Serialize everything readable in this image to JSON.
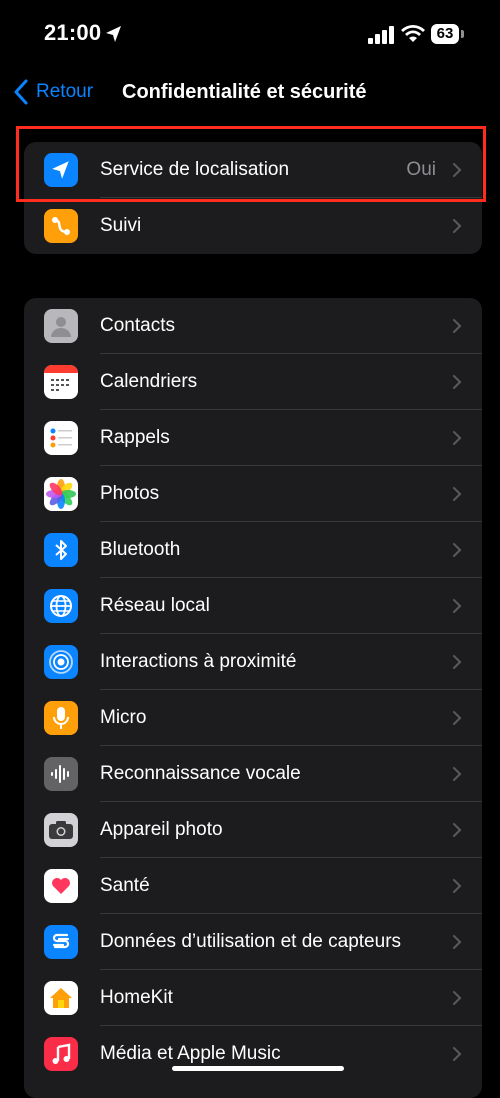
{
  "status_bar": {
    "time": "21:00",
    "battery": "63"
  },
  "nav": {
    "back_label": "Retour",
    "title": "Confidentialité et sécurité"
  },
  "group1": [
    {
      "name": "location",
      "label": "Service de localisation",
      "value": "Oui",
      "icon": "location-arrow-icon",
      "color": "#0a84ff"
    },
    {
      "name": "tracking",
      "label": "Suivi",
      "value": "",
      "icon": "tracking-icon",
      "color": "#ff9f0a"
    }
  ],
  "group2": [
    {
      "label": "Contacts",
      "icon": "contacts-icon",
      "color": "#8e8e93"
    },
    {
      "label": "Calendriers",
      "icon": "calendar-icon",
      "color": "#ffffff"
    },
    {
      "label": "Rappels",
      "icon": "reminders-icon",
      "color": "#ffffff"
    },
    {
      "label": "Photos",
      "icon": "photos-icon",
      "color": "#ffffff"
    },
    {
      "label": "Bluetooth",
      "icon": "bluetooth-icon",
      "color": "#0a84ff"
    },
    {
      "label": "Réseau local",
      "icon": "globe-icon",
      "color": "#0a84ff"
    },
    {
      "label": "Interactions à proximité",
      "icon": "nearby-icon",
      "color": "#0a84ff"
    },
    {
      "label": "Micro",
      "icon": "microphone-icon",
      "color": "#ff9f0a"
    },
    {
      "label": "Reconnaissance vocale",
      "icon": "waveform-icon",
      "color": "#636366"
    },
    {
      "label": "Appareil photo",
      "icon": "camera-icon",
      "color": "#3a3a3c"
    },
    {
      "label": "Santé",
      "icon": "health-heart-icon",
      "color": "#ffffff"
    },
    {
      "label": "Données d’utilisation et de capteurs",
      "icon": "sensor-data-icon",
      "color": "#0a84ff"
    },
    {
      "label": "HomeKit",
      "icon": "home-icon",
      "color": "#ffffff"
    },
    {
      "label": "Média et Apple Music",
      "icon": "music-icon",
      "color": "#fa2d48"
    }
  ],
  "colors": {
    "accent": "#0a84ff",
    "highlight": "#ff2d1f"
  }
}
